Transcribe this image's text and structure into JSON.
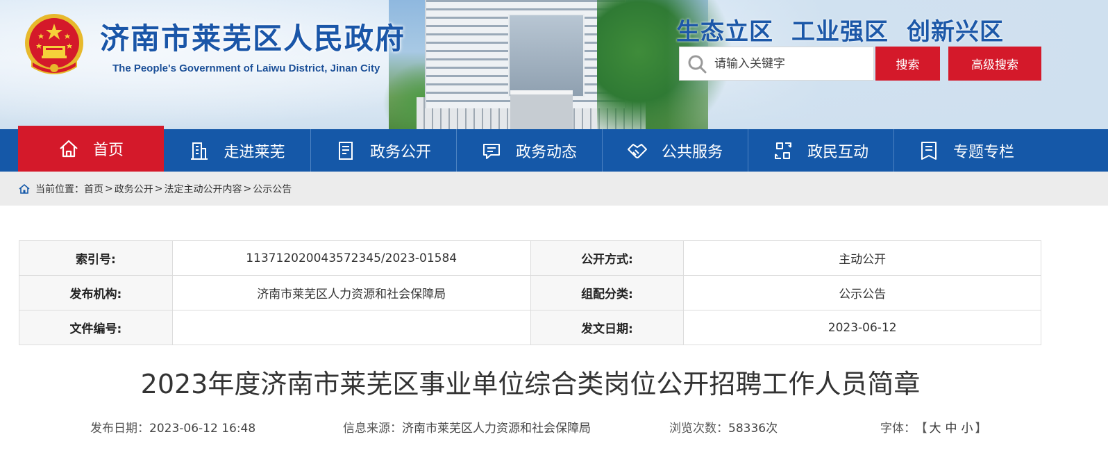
{
  "header": {
    "title": "济南市莱芜区人民政府",
    "subtitle": "The People's Government of Laiwu District, Jinan City",
    "slogans": [
      "生态立区",
      "工业强区",
      "创新兴区"
    ],
    "search": {
      "placeholder": "请输入关键字",
      "search_button": "搜索",
      "advanced_button": "高级搜索"
    }
  },
  "nav": {
    "items": [
      {
        "label": "首页",
        "icon": "home-icon"
      },
      {
        "label": "走进莱芜",
        "icon": "building-icon"
      },
      {
        "label": "政务公开",
        "icon": "document-icon"
      },
      {
        "label": "政务动态",
        "icon": "chat-icon"
      },
      {
        "label": "公共服务",
        "icon": "handshake-icon"
      },
      {
        "label": "政民互动",
        "icon": "exchange-icon"
      },
      {
        "label": "专题专栏",
        "icon": "column-icon"
      }
    ]
  },
  "breadcrumb": {
    "prefix": "当前位置：",
    "items": [
      "首页",
      "政务公开",
      "法定主动公开内容",
      "公示公告"
    ],
    "separator": ">"
  },
  "info": {
    "rows": [
      {
        "k1": "索引号:",
        "v1": "113712020043572345/2023-01584",
        "k2": "公开方式:",
        "v2": "主动公开"
      },
      {
        "k1": "发布机构:",
        "v1": "济南市莱芜区人力资源和社会保障局",
        "k2": "组配分类:",
        "v2": "公示公告"
      },
      {
        "k1": "文件编号:",
        "v1": "",
        "k2": "发文日期:",
        "v2": "2023-06-12"
      }
    ]
  },
  "article": {
    "title": "2023年度济南市莱芜区事业单位综合类岗位公开招聘工作人员简章",
    "meta": {
      "date_label": "发布日期：",
      "date": "2023-06-12 16:48",
      "source_label": "信息来源：",
      "source": "济南市莱芜区人力资源和社会保障局",
      "views_label": "浏览次数：",
      "views": "58336次",
      "font_label": "字体：",
      "font_open": "【",
      "font_options": [
        "大",
        "中",
        "小"
      ],
      "font_close": "】"
    }
  },
  "colors": {
    "brand_blue": "#1558a8",
    "accent_red": "#d4192a",
    "title_blue": "#1a56a8"
  }
}
